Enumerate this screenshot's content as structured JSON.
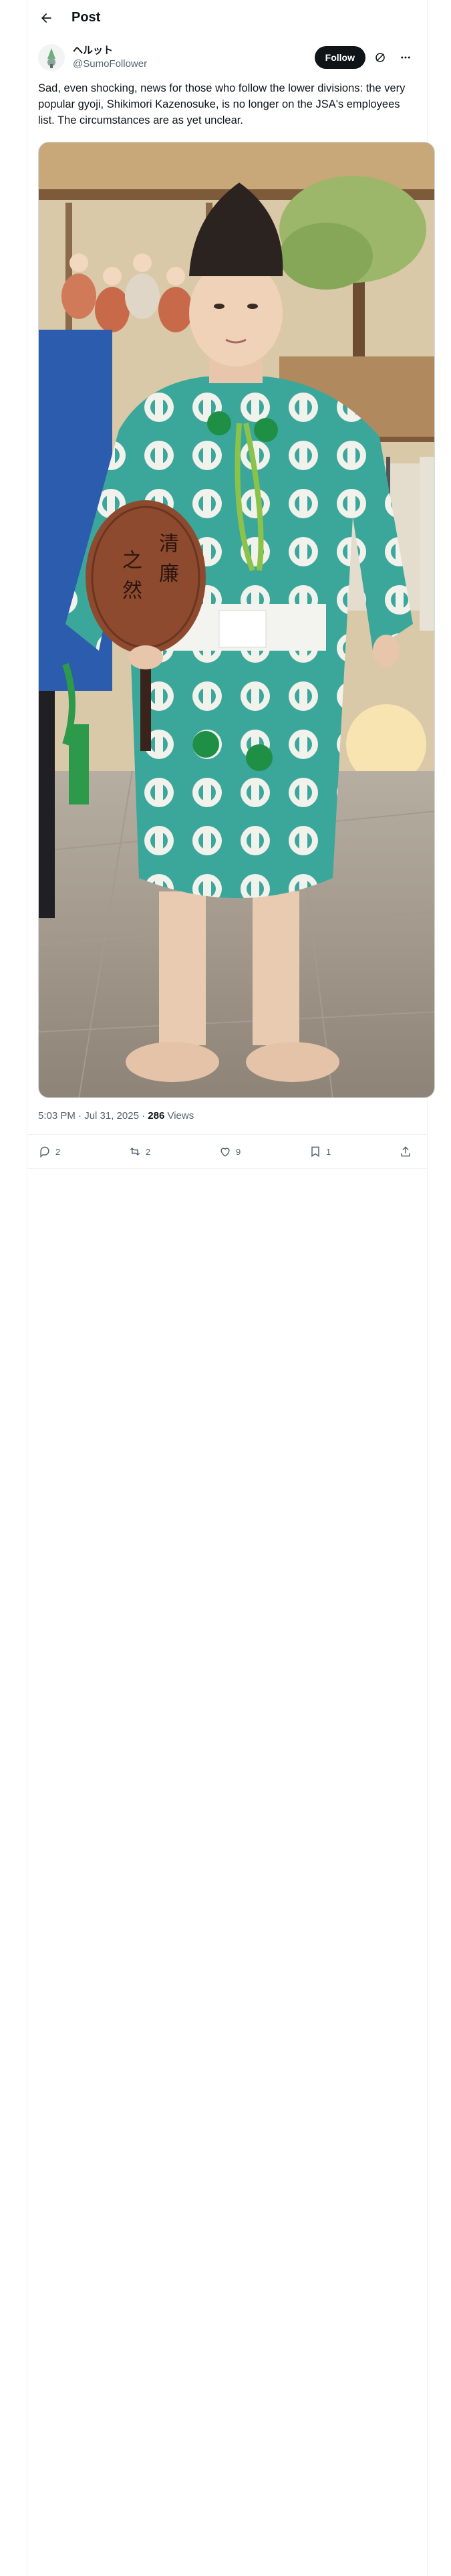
{
  "header": {
    "title": "Post"
  },
  "author": {
    "name": "ヘルット",
    "handle": "@SumoFollower"
  },
  "buttons": {
    "follow": "Follow"
  },
  "post": {
    "text": "Sad, even shocking, news for those who follow the lower divisions: the very popular gyoji, Shikimori Kazenosuke, is no longer on the JSA's employees list. The circumstances are as yet unclear.",
    "timestamp": "5:03 PM · Jul 31, 2025",
    "views_count": "286",
    "views_label": "Views"
  },
  "metrics": {
    "replies": "2",
    "reposts": "2",
    "likes": "9",
    "bookmarks": "1"
  },
  "image": {
    "fan_text": [
      "清",
      "廉",
      "之",
      "然"
    ]
  },
  "colors": {
    "accent": "#0f1419",
    "muted": "#536471",
    "kimono": "#3aa79a"
  }
}
